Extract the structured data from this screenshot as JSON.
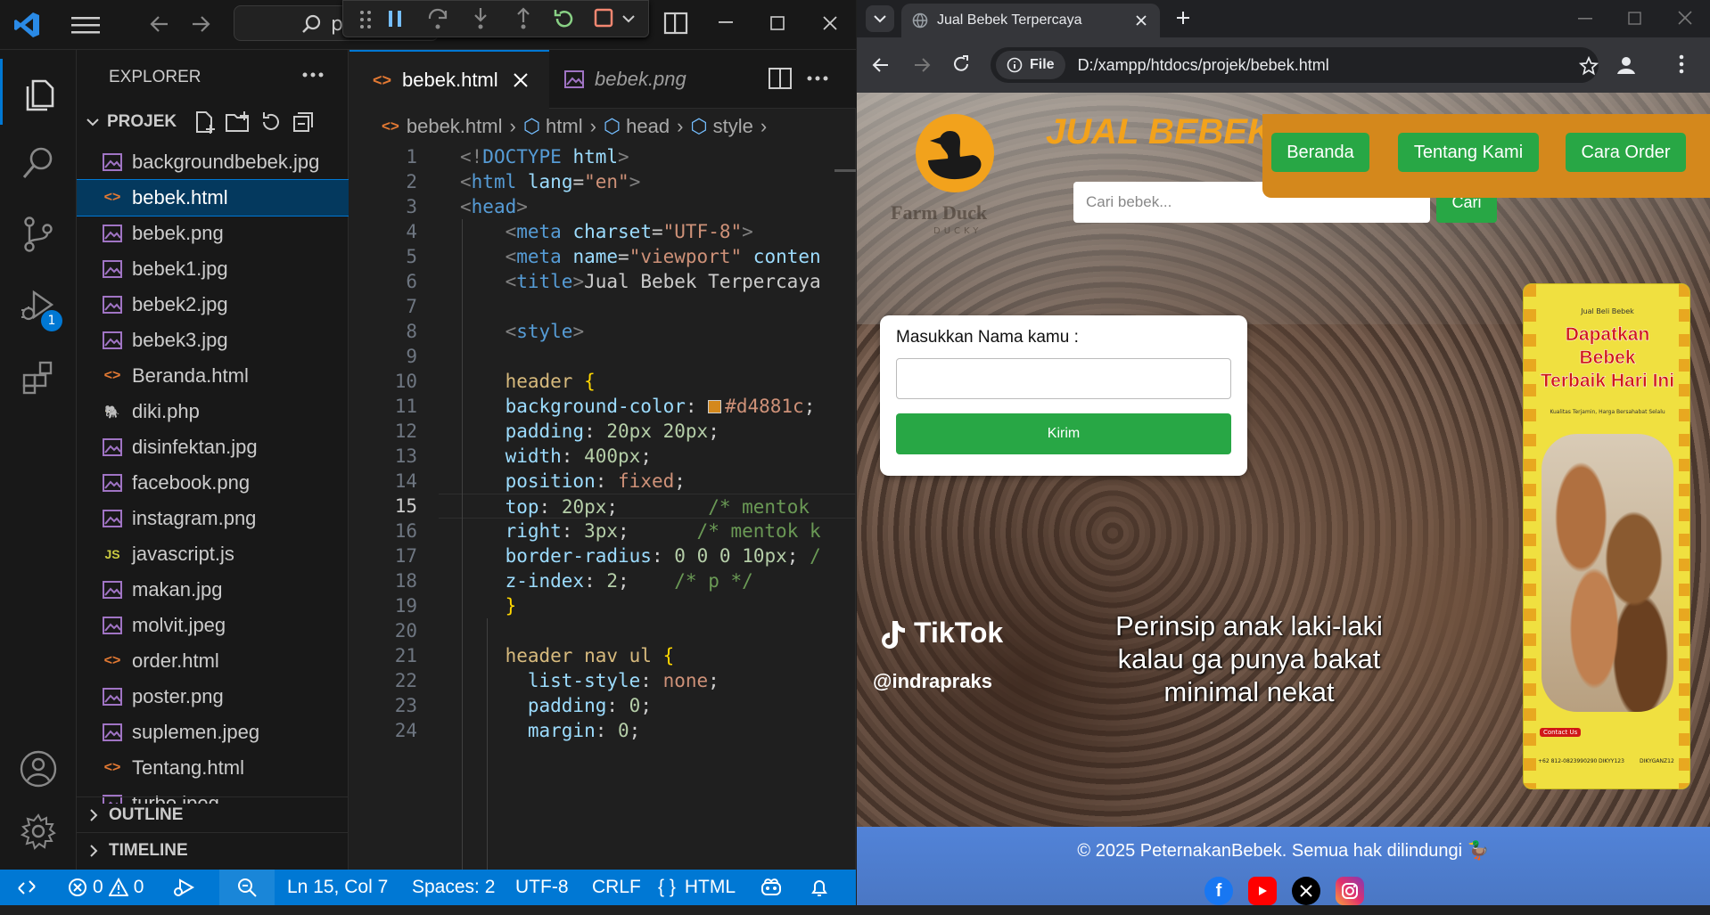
{
  "vscode": {
    "title_search": "p",
    "sidebar_title": "EXPLORER",
    "folder": "PROJEK",
    "files": [
      {
        "name": "backgroundbebek.jpg",
        "icon": "image"
      },
      {
        "name": "bebek.html",
        "icon": "html",
        "selected": true
      },
      {
        "name": "bebek.png",
        "icon": "image"
      },
      {
        "name": "bebek1.jpg",
        "icon": "image"
      },
      {
        "name": "bebek2.jpg",
        "icon": "image"
      },
      {
        "name": "bebek3.jpg",
        "icon": "image"
      },
      {
        "name": "Beranda.html",
        "icon": "html"
      },
      {
        "name": "diki.php",
        "icon": "php"
      },
      {
        "name": "disinfektan.jpg",
        "icon": "image"
      },
      {
        "name": "facebook.png",
        "icon": "image"
      },
      {
        "name": "instagram.png",
        "icon": "image"
      },
      {
        "name": "javascript.js",
        "icon": "js"
      },
      {
        "name": "makan.jpg",
        "icon": "image"
      },
      {
        "name": "molvit.jpeg",
        "icon": "image"
      },
      {
        "name": "order.html",
        "icon": "html"
      },
      {
        "name": "poster.png",
        "icon": "image"
      },
      {
        "name": "suplemen.jpeg",
        "icon": "image"
      },
      {
        "name": "Tentang.html",
        "icon": "html"
      },
      {
        "name": "turbo.jpeg",
        "icon": "image"
      }
    ],
    "outline": "OUTLINE",
    "timeline": "TIMELINE",
    "badge": "1",
    "tabs": [
      {
        "label": "bebek.html",
        "active": true
      },
      {
        "label": "bebek.png",
        "active": false
      }
    ],
    "breadcrumb": [
      "bebek.html",
      "html",
      "head",
      "style"
    ],
    "code_lines": [
      {
        "n": "1",
        "html": "<span class='t'>&lt;!</span><span class='tg'>DOCTYPE</span> <span class='at'>html</span><span class='t'>&gt;</span>"
      },
      {
        "n": "2",
        "html": "<span class='t'>&lt;</span><span class='tg'>html</span> <span class='at'>lang</span>=<span class='st'>\"en\"</span><span class='t'>&gt;</span>"
      },
      {
        "n": "3",
        "html": "<span class='t'>&lt;</span><span class='tg'>head</span><span class='t'>&gt;</span>"
      },
      {
        "n": "4",
        "html": "    <span class='t'>&lt;</span><span class='tg'>meta</span> <span class='at'>charset</span>=<span class='st'>\"UTF-8\"</span><span class='t'>&gt;</span>"
      },
      {
        "n": "5",
        "html": "    <span class='t'>&lt;</span><span class='tg'>meta</span> <span class='at'>name</span>=<span class='st'>\"viewport\"</span> <span class='at'>conten</span>"
      },
      {
        "n": "6",
        "html": "    <span class='t'>&lt;</span><span class='tg'>title</span><span class='t'>&gt;</span>Jual Bebek Terpercaya"
      },
      {
        "n": "7",
        "html": ""
      },
      {
        "n": "8",
        "html": "    <span class='t'>&lt;</span><span class='tg'>style</span><span class='t'>&gt;</span>"
      },
      {
        "n": "9",
        "html": ""
      },
      {
        "n": "10",
        "html": "    <span class='sel'>header</span> <span class='br'>{</span>"
      },
      {
        "n": "11",
        "html": "    <span class='pr'>background-color</span>: <span class='swatch'></span><span class='kw'>#d4881c</span>;"
      },
      {
        "n": "12",
        "html": "    <span class='pr'>padding</span>: <span class='nu'>20px</span> <span class='nu'>20px</span>;"
      },
      {
        "n": "13",
        "html": "    <span class='pr'>width</span>: <span class='nu'>400px</span>;"
      },
      {
        "n": "14",
        "html": "    <span class='pr'>position</span>: <span class='kw'>fixed</span>;"
      },
      {
        "n": "15",
        "html": "    <span class='pr'>top</span>: <span class='nu'>20px</span>;        <span class='cm'>/* mentok</span>"
      },
      {
        "n": "16",
        "html": "    <span class='pr'>right</span>: <span class='nu'>3px</span>;      <span class='cm'>/* mentok k</span>"
      },
      {
        "n": "17",
        "html": "    <span class='pr'>border-radius</span>: <span class='nu'>0</span> <span class='nu'>0</span> <span class='nu'>0</span> <span class='nu'>10px</span>; <span class='cm'>/</span>"
      },
      {
        "n": "18",
        "html": "    <span class='pr'>z-index</span>: <span class='nu'>2</span>;    <span class='cm'>/* p */</span>"
      },
      {
        "n": "19",
        "html": "    <span class='br'>}</span>"
      },
      {
        "n": "20",
        "html": ""
      },
      {
        "n": "21",
        "html": "    <span class='sel'>header nav ul</span> <span class='br'>{</span>"
      },
      {
        "n": "22",
        "html": "      <span class='pr'>list-style</span>: <span class='kw'>none</span>;"
      },
      {
        "n": "23",
        "html": "      <span class='pr'>padding</span>: <span class='nu'>0</span>;"
      },
      {
        "n": "24",
        "html": "      <span class='pr'>margin</span>: <span class='nu'>0</span>;"
      }
    ],
    "status": {
      "errors": "0",
      "warnings": "0",
      "cursor": "Ln 15, Col 7",
      "spaces": "Spaces: 2",
      "encoding": "UTF-8",
      "eol": "CRLF",
      "language": "HTML",
      "language_icon": "{ }"
    }
  },
  "browser": {
    "tab_title": "Jual Bebek Terpercaya",
    "url_chip": "File",
    "url": "D:/xampp/htdocs/projek/bebek.html",
    "site": {
      "brand_title": "JUAL BEBEK",
      "logo_text": "Farm Duck",
      "logo_sub": "DUCKY",
      "nav": [
        "Beranda",
        "Tentang Kami",
        "Cara Order"
      ],
      "search_placeholder": "Cari bebek...",
      "search_button": "Cari",
      "form_label": "Masukkan Nama kamu :",
      "form_value": "",
      "form_button": "Kirim",
      "video_brand": "TikTok",
      "video_user": "@indrapraks",
      "video_caption_1": "Perinsip anak laki-laki",
      "video_caption_2": "kalau ga punya bakat",
      "video_caption_3": "minimal nekat",
      "poster_small": "Jual Beli Bebek",
      "poster_title_1": "Dapatkan Bebek",
      "poster_title_2": "Terbaik Hari Ini",
      "poster_sub": "Kualitas Terjamin, Harga Bersahabat Selalu",
      "poster_contact": "Contact Us",
      "poster_phone": "+62 812-0823990290",
      "poster_fb": "DIKYY123",
      "poster_ig": "DIKYGANZ12",
      "footer_text": "© 2025 PeternakanBebek. Semua hak dilindungi 🦆"
    },
    "colors": {
      "header_orange": "#d4881c",
      "nav_green": "#28a745",
      "footer_blue": "#4a7fd6",
      "poster_yellow": "#f0e040"
    }
  }
}
